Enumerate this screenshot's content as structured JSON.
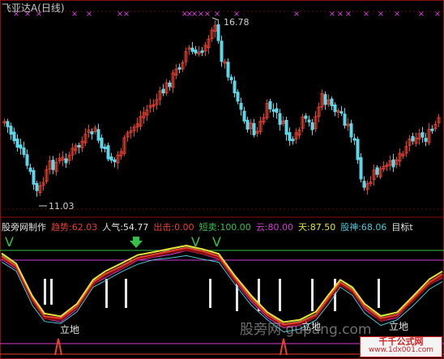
{
  "header": {
    "title": "飞亚达A",
    "period": "(日线)"
  },
  "price_panel": {
    "high_label": "16.78",
    "low_label": "11.03",
    "markers": "×"
  },
  "indicator_bar": {
    "items": [
      {
        "label": "股旁网制作",
        "color": "#e0e0e0"
      },
      {
        "label": "趋势:62.03",
        "color": "#e8402e"
      },
      {
        "label": "人气:54.77",
        "color": "#e0e0e0"
      },
      {
        "label": "出击:0.00",
        "color": "#e8402e"
      },
      {
        "label": "短卖:100.00",
        "color": "#35c04a"
      },
      {
        "label": "云:80.00",
        "color": "#d23cd2"
      },
      {
        "label": "天:87.50",
        "color": "#e6e23a"
      },
      {
        "label": "股神:68.06",
        "color": "#48c8d8"
      },
      {
        "label": "目标t",
        "color": "#e0e0e0"
      }
    ]
  },
  "lower_panel": {
    "signal_label_1": "立地",
    "signal_label_2": "立地",
    "signal_label_3": "立地",
    "v_marker": "V"
  },
  "watermark": {
    "text": "股旁网 gupang.com"
  },
  "logo": {
    "line1": "千千公式网",
    "line2": "www.1dx001.com"
  },
  "colors": {
    "background": "#000000",
    "up_candle": "#e8402e",
    "down_candle": "#5ad7e8",
    "marker": "#e040e0"
  }
}
